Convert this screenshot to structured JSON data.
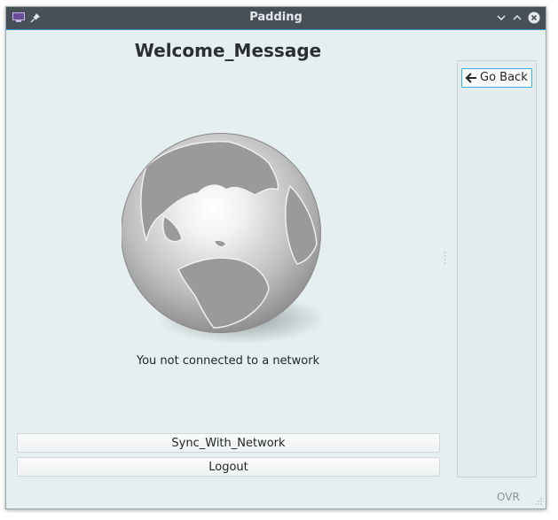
{
  "window": {
    "title": "Padding"
  },
  "main": {
    "heading": "Welcome_Message",
    "status_text": "You not connected to a network",
    "sync_button": "Sync_With_Network",
    "logout_button": "Logout"
  },
  "side": {
    "go_back_label": "Go Back"
  },
  "statusbar": {
    "mode": "OVR"
  },
  "icons": {
    "globe": "globe-icon",
    "go_back": "arrow-left-icon"
  },
  "colors": {
    "window_bg": "#e5eff0",
    "titlebar": "#485057",
    "focus": "#3daee9"
  }
}
